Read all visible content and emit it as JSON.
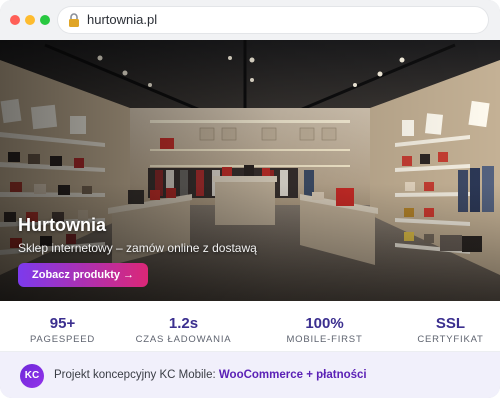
{
  "browser": {
    "url": "hurtownia.pl"
  },
  "hero": {
    "title": "Hurtownia",
    "subtitle": "Sklep internetowy – zamów online z dostawą",
    "cta_label": "Zobacz produkty →"
  },
  "stats": [
    {
      "value": "95+",
      "label": "PAGESPEED"
    },
    {
      "value": "1.2s",
      "label": "CZAS ŁADOWANIA"
    },
    {
      "value": "100%",
      "label": "MOBILE-FIRST"
    },
    {
      "value": "SSL",
      "label": "CERTYFIKAT"
    }
  ],
  "footer": {
    "avatar": "KC",
    "text": "Projekt koncepcyjny KC Mobile: ",
    "highlight": "WooCommerce + płatności"
  },
  "colors": {
    "accent": "#3b2f8f",
    "cta_start": "#7c3aed",
    "cta_end": "#db2777"
  }
}
